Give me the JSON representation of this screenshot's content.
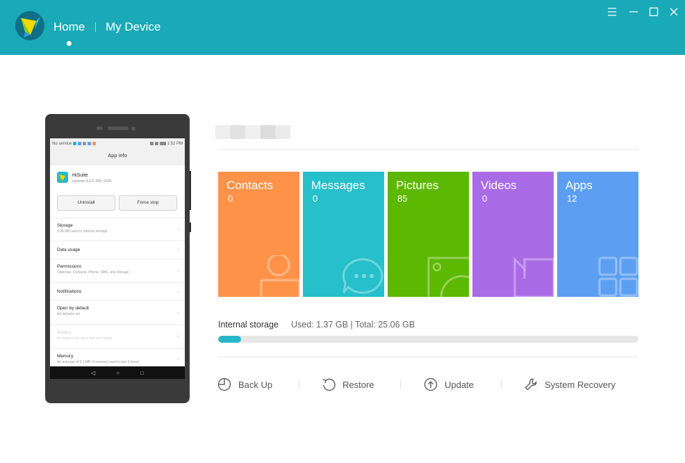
{
  "header": {
    "nav": [
      "Home",
      "My Device"
    ],
    "active_tab": "Home",
    "colors": {
      "bar": "#1aa9b7",
      "logo": "#0f6f86"
    },
    "window_controls": [
      "menu-icon",
      "minimize-icon",
      "maximize-icon",
      "close-icon"
    ]
  },
  "phone": {
    "status_left": "No service",
    "status_right": "1:52 PM",
    "appbar_title": "App info",
    "app_name": "HiSuite",
    "app_version": "version 4.0.5.300_OVE",
    "buttons": [
      "Uninstall",
      "Force stop"
    ],
    "settings": [
      {
        "title": "Storage",
        "sub": "6.08 MB used in Internal storage"
      },
      {
        "title": "Data usage",
        "sub": ""
      },
      {
        "title": "Permissions",
        "sub": "Calendar, Contacts, Phone, SMS, and Storage"
      },
      {
        "title": "Notifications",
        "sub": ""
      },
      {
        "title": "Open by default",
        "sub": "No defaults set"
      },
      {
        "title": "Battery",
        "sub": "No battery use since last full charge"
      },
      {
        "title": "Memory",
        "sub": "An average of 5.3 MB of memory used in last 3 hours"
      }
    ]
  },
  "tiles": [
    {
      "label": "Contacts",
      "count": "0",
      "color": "#ff9249",
      "icon": "contact-icon"
    },
    {
      "label": "Messages",
      "count": "0",
      "color": "#26bfca",
      "icon": "message-icon"
    },
    {
      "label": "Pictures",
      "count": "85",
      "color": "#5cb800",
      "icon": "picture-icon"
    },
    {
      "label": "Videos",
      "count": "0",
      "color": "#a96be6",
      "icon": "video-icon"
    },
    {
      "label": "Apps",
      "count": "12",
      "color": "#5c9ff2",
      "icon": "apps-icon"
    }
  ],
  "storage": {
    "label": "Internal storage",
    "stats": "Used: 1.37 GB | Total: 25.06 GB",
    "used_fraction": 0.0547,
    "color": "#27b8c8"
  },
  "actions": [
    {
      "label": "Back Up",
      "icon": "backup-icon"
    },
    {
      "label": "Restore",
      "icon": "restore-icon"
    },
    {
      "label": "Update",
      "icon": "update-icon"
    },
    {
      "label": "System Recovery",
      "icon": "wrench-icon"
    }
  ]
}
